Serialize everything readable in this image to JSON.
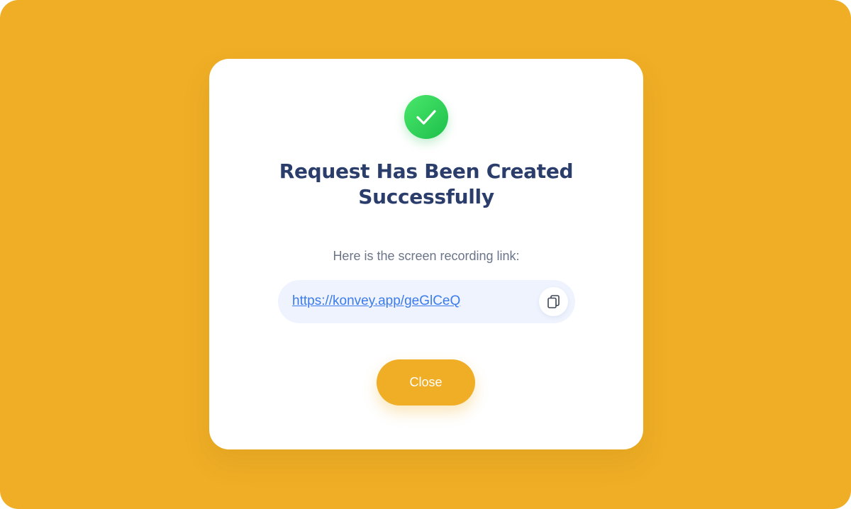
{
  "theme": {
    "backdrop_color": "#EFAE25",
    "accent_color": "#EFAE25",
    "success_color": "#1DBF4C",
    "title_color": "#2B3D6B",
    "link_color": "#3B7BEB"
  },
  "dialog": {
    "icon": "check-circle-icon",
    "title": "Request Has Been Created Successfully",
    "subtitle": "Here is the screen recording link:",
    "link": {
      "text": "https://konvey.app/geGlCeQ",
      "copy_icon": "copy-icon"
    },
    "close_label": "Close"
  }
}
